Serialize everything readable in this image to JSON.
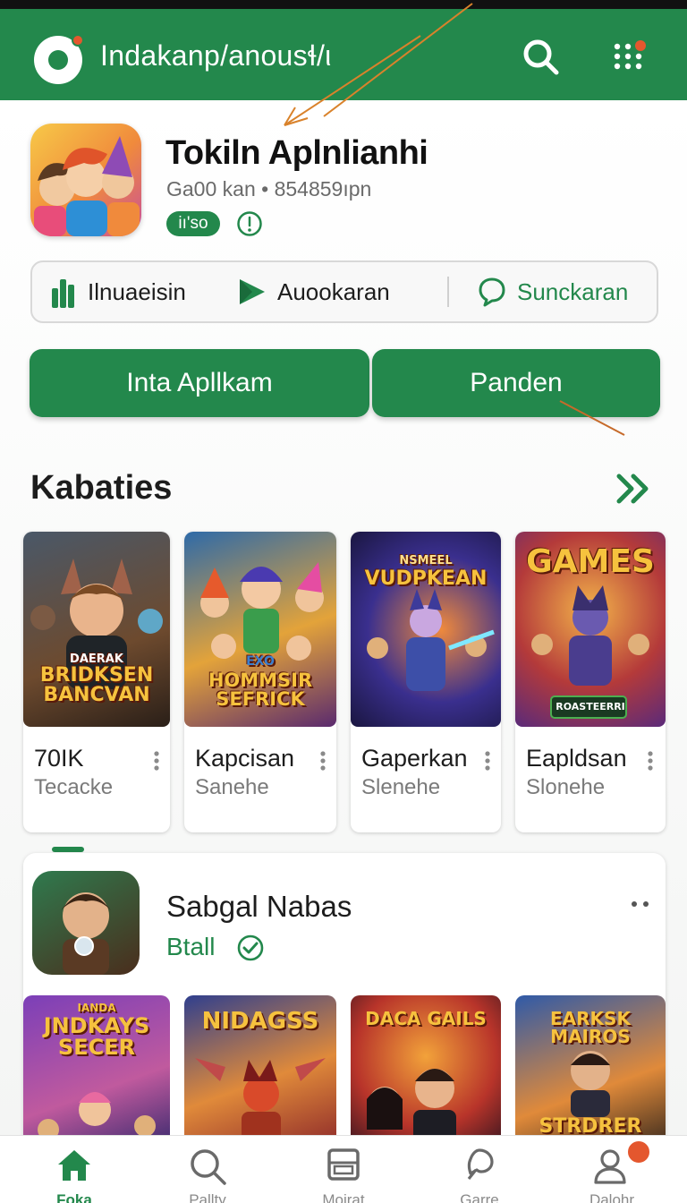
{
  "appbar": {
    "title": "Indakanp/anousɬ/ι",
    "icons": [
      "logo-icon",
      "search-icon",
      "menu-dots-icon"
    ],
    "color": "#23884c"
  },
  "app": {
    "title": "Tokiln Aplnlianhi",
    "subtitle": "Ga00 kan  • 854859ıpn",
    "badge": "iı'so"
  },
  "segments": [
    {
      "label": "Ilnuaeisin",
      "icon": "bars-icon"
    },
    {
      "label": "Auookaran",
      "icon": "play-icon"
    },
    {
      "label": "Sunckaran",
      "icon": "chat-icon"
    }
  ],
  "buttons": {
    "primary": "Inta Apllkam",
    "secondary": "Panden"
  },
  "section": {
    "title": "Kabaties",
    "more_icon": "double-chevron-right-icon"
  },
  "cards": [
    {
      "name": "70IK",
      "sub": "Tecacke",
      "art_title": "BRIDKSEN BANCVAN",
      "art_kicker": "DAERAK"
    },
    {
      "name": "Kapcisan",
      "sub": "Sanehe",
      "art_title": "HOMMSIR SEFRICK",
      "art_kicker": "EXO"
    },
    {
      "name": "Gaperkan",
      "sub": "Slenehe",
      "art_title": "VUDPKEAN",
      "art_kicker": "NSMEEL"
    },
    {
      "name": "Eapldsan",
      "sub": "Slonehe",
      "art_title": "GAMES",
      "art_kicker": "ROASTEERRI"
    }
  ],
  "panel": {
    "title": "Sabgal Nabas",
    "sub": "Btall"
  },
  "cards2": [
    {
      "art_title": "JNDKAYS SECER",
      "art_kicker": "IANDA"
    },
    {
      "art_title": "NIDAGSS",
      "art_kicker": ""
    },
    {
      "art_title": "DACA GAILS",
      "art_kicker": ""
    },
    {
      "art_title": "EARKSK MAIROS",
      "art_kicker": "STRDRER"
    }
  ],
  "nav": [
    {
      "label": "Foka",
      "icon": "home-icon"
    },
    {
      "label": "Pallty",
      "icon": "search-icon"
    },
    {
      "label": "Moirat",
      "icon": "library-icon"
    },
    {
      "label": "Garre",
      "icon": "games-icon"
    },
    {
      "label": "Dalohr",
      "icon": "profile-icon"
    }
  ]
}
